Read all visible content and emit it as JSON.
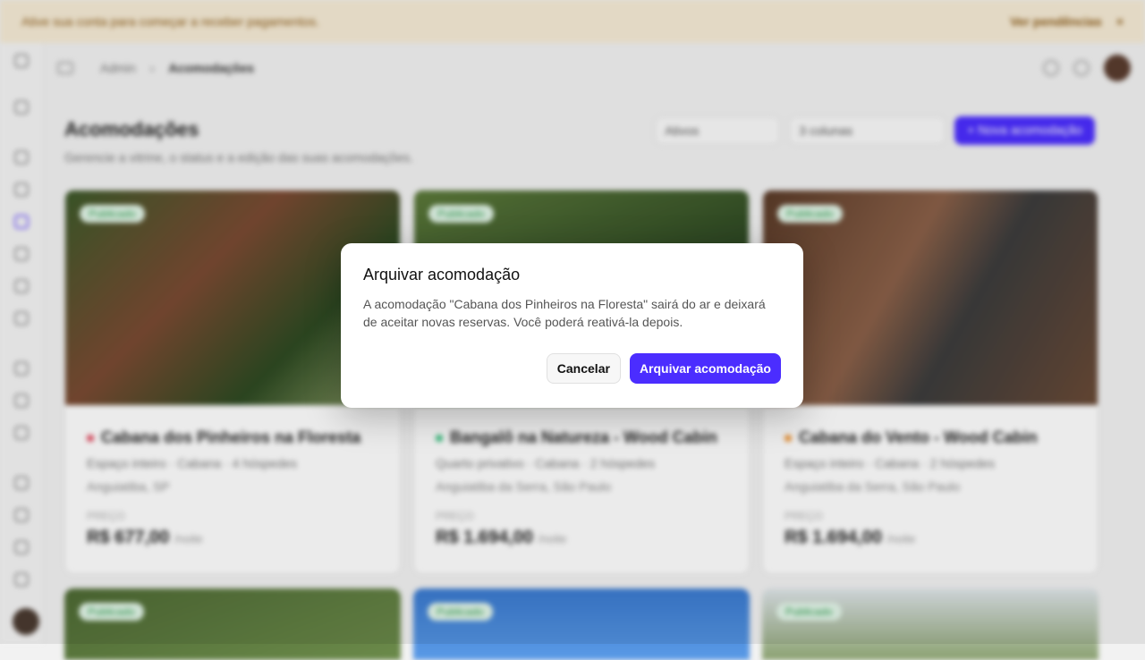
{
  "banner": {
    "text": "Ative sua conta para começar a receber pagamentos.",
    "link": "Ver pendências",
    "close_icon": "close-icon"
  },
  "topbar": {
    "crumb_root": "Admin",
    "crumb_current": "Acomodações"
  },
  "page": {
    "title": "Acomodações",
    "subtitle": "Gerencie a vitrine, o status e a edição das suas acomodações.",
    "filter_status": "Ativos",
    "filter_columns": "3 colunas",
    "new_button": "+ Nova acomodação"
  },
  "cards": [
    {
      "badge": "Publicado",
      "title": "Cabana dos Pinheiros na Floresta",
      "subtitle": "Espaço inteiro · Cabana · 4 hóspedes",
      "location": "Anguiatiba, SP",
      "price_label": "PREÇO",
      "price": "R$ 677,00",
      "unit": "/noite",
      "dot_color": "#e0445a"
    },
    {
      "badge": "Publicado",
      "title": "Bangalô na Natureza - Wood Cabin",
      "subtitle": "Quarto privativo · Cabana · 2 hóspedes",
      "location": "Anguiatiba da Serra, São Paulo",
      "price_label": "PREÇO",
      "price": "R$ 1.694,00",
      "unit": "/noite",
      "dot_color": "#2fbf7a"
    },
    {
      "badge": "Publicado",
      "title": "Cabana do Vento - Wood Cabin",
      "subtitle": "Espaço inteiro · Cabana · 2 hóspedes",
      "location": "Anguiatiba da Serra, São Paulo",
      "price_label": "PREÇO",
      "price": "R$ 1.694,00",
      "unit": "/noite",
      "dot_color": "#f0902a"
    }
  ],
  "row2_badges": [
    "Publicado",
    "Publicado",
    "Publicado"
  ],
  "modal": {
    "title": "Arquivar acomodação",
    "description": "A acomodação \"Cabana dos Pinheiros na Floresta\" sairá do ar e deixará de aceitar novas reservas. Você poderá reativá-la depois.",
    "cancel": "Cancelar",
    "confirm": "Arquivar acomodação"
  },
  "colors": {
    "accent": "#4b2dff"
  }
}
